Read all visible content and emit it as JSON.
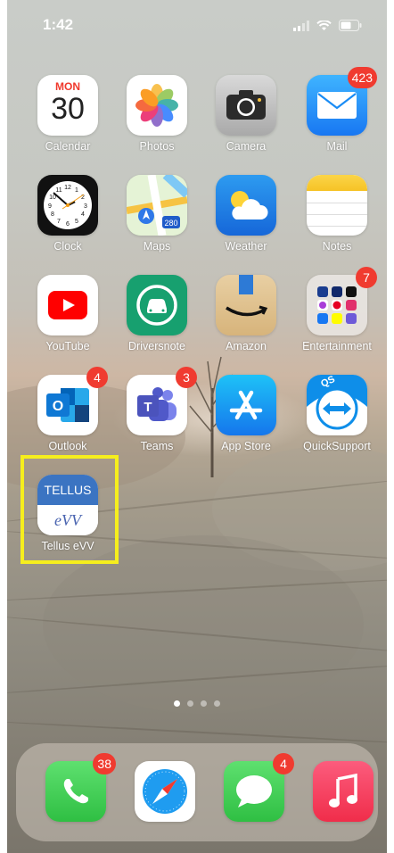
{
  "status": {
    "time": "1:42"
  },
  "apps": [
    {
      "name": "Calendar"
    },
    {
      "name": "Photos"
    },
    {
      "name": "Camera"
    },
    {
      "name": "Mail",
      "badge": "423"
    },
    {
      "name": "Clock"
    },
    {
      "name": "Maps"
    },
    {
      "name": "Weather"
    },
    {
      "name": "Notes"
    },
    {
      "name": "YouTube"
    },
    {
      "name": "Driversnote"
    },
    {
      "name": "Amazon"
    },
    {
      "name": "Entertainment",
      "badge": "7"
    },
    {
      "name": "Outlook",
      "badge": "4"
    },
    {
      "name": "Teams",
      "badge": "3"
    },
    {
      "name": "App Store"
    },
    {
      "name": "QuickSupport"
    },
    {
      "name": "Tellus eVV"
    }
  ],
  "calendar": {
    "day": "MON",
    "date": "30"
  },
  "maps": {
    "shield": "280"
  },
  "tellus": {
    "top": "TELLUS",
    "bottom": "eVV"
  },
  "quicksupport": {
    "mark": "QS"
  },
  "outlook": {
    "letter": "O"
  },
  "teams": {
    "letter": "T"
  },
  "page_indicator": {
    "pages": 4,
    "active": 1
  },
  "dock": [
    {
      "name": "Phone",
      "badge": "38"
    },
    {
      "name": "Safari"
    },
    {
      "name": "Messages",
      "badge": "4"
    },
    {
      "name": "Music"
    }
  ],
  "colors": {
    "badge": "#f03b30",
    "highlight": "#f6ee1d"
  }
}
